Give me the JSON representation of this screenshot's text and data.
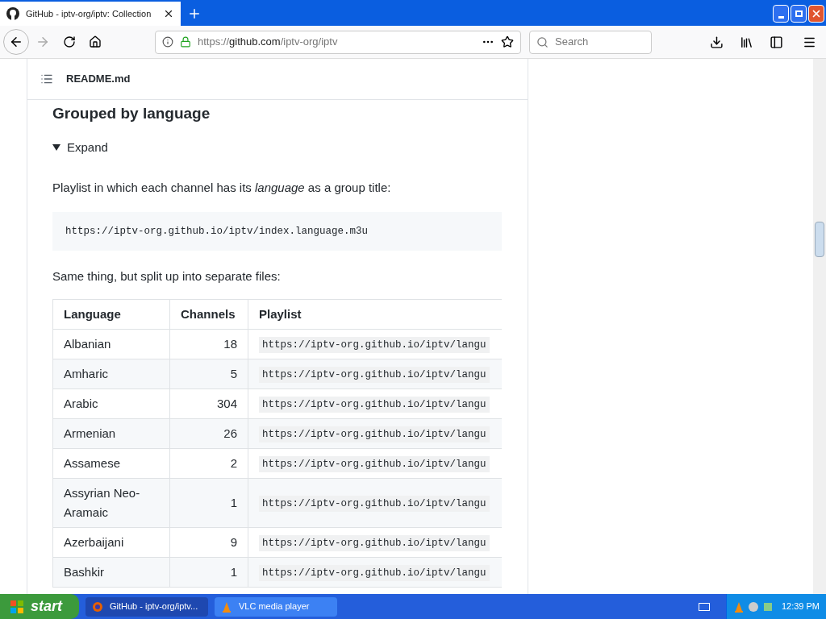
{
  "browser": {
    "tab": {
      "title": "GitHub - iptv-org/iptv: Collection",
      "selected": true
    },
    "url": {
      "prefix": "https://",
      "host": "github.com",
      "path": "/iptv-org/iptv"
    },
    "search": {
      "placeholder": "Search"
    }
  },
  "readme": {
    "filename": "README.md",
    "heading": "Grouped by language",
    "details": {
      "label": "Expand",
      "expanded": true
    },
    "intro": "Playlist in which each channel has its *language* as a group title:",
    "code": "https://iptv-org.github.io/iptv/index.language.m3u",
    "split_text": "Same thing, but split up into separate files:",
    "table": {
      "columns": [
        "Language",
        "Channels",
        "Playlist"
      ],
      "rows": [
        {
          "language": "Albanian",
          "channels": "18",
          "playlist": "https://iptv-org.github.io/iptv/langu"
        },
        {
          "language": "Amharic",
          "channels": "5",
          "playlist": "https://iptv-org.github.io/iptv/langu"
        },
        {
          "language": "Arabic",
          "channels": "304",
          "playlist": "https://iptv-org.github.io/iptv/langu"
        },
        {
          "language": "Armenian",
          "channels": "26",
          "playlist": "https://iptv-org.github.io/iptv/langu"
        },
        {
          "language": "Assamese",
          "channels": "2",
          "playlist": "https://iptv-org.github.io/iptv/langu"
        },
        {
          "language": "Assyrian Neo-Aramaic",
          "channels": "1",
          "playlist": "https://iptv-org.github.io/iptv/langu"
        },
        {
          "language": "Azerbaijani",
          "channels": "9",
          "playlist": "https://iptv-org.github.io/iptv/langu"
        },
        {
          "language": "Bashkir",
          "channels": "1",
          "playlist": "https://iptv-org.github.io/iptv/langu"
        }
      ]
    }
  },
  "taskbar": {
    "start": "start",
    "tasks": [
      {
        "label": "GitHub - iptv-org/iptv...",
        "selected": true
      },
      {
        "label": "VLC media player",
        "selected": false
      }
    ],
    "clock": "12:39 PM"
  }
}
